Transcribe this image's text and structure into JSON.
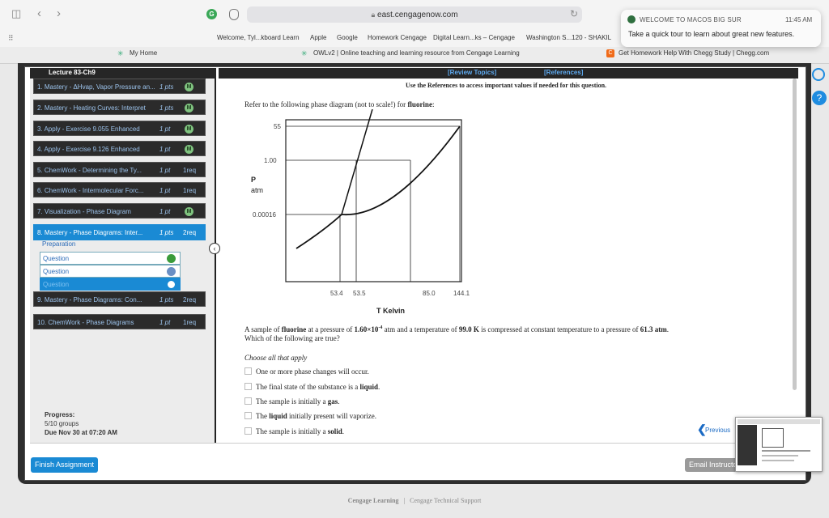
{
  "browser": {
    "url": "east.cengagenow.com",
    "favorites": [
      "Welcome, Tyl...kboard Learn",
      "Apple",
      "Google",
      "Homework Cengage",
      "Digital Learn...ks – Cengage",
      "Washington S...120 - SHAKIL"
    ],
    "tabs": [
      "My Home",
      "OWLv2 | Online teaching and learning resource from Cengage Learning",
      "Get Homework Help With Chegg Study | Chegg.com"
    ]
  },
  "notification": {
    "title": "WELCOME TO MACOS BIG SUR",
    "time": "11:45 AM",
    "body": "Take a quick tour to learn about great new features."
  },
  "sidebar": {
    "header": "Lecture 83-Ch9",
    "items": [
      {
        "label": "1. Mastery - ΔHvap, Vapor Pressure an...",
        "pts": "1 pts",
        "badge": "M"
      },
      {
        "label": "2. Mastery - Heating Curves: Interpret",
        "pts": "1 pts",
        "badge": "M"
      },
      {
        "label": "3. Apply - Exercise 9.055 Enhanced",
        "pts": "1 pt",
        "badge": "M"
      },
      {
        "label": "4. Apply - Exercise 9.126 Enhanced",
        "pts": "1 pt",
        "badge": "M"
      },
      {
        "label": "5. ChemWork - Determining the Ty...",
        "pts": "1 pt",
        "req": "1req"
      },
      {
        "label": "6. ChemWork - Intermolecular Forc...",
        "pts": "1 pt",
        "req": "1req"
      },
      {
        "label": "7. Visualization - Phase Diagram",
        "pts": "1 pt",
        "badge": "M"
      },
      {
        "label": "8. Mastery - Phase Diagrams: Inter...",
        "pts": "1 pts",
        "req": "2req"
      },
      {
        "label": "9. Mastery - Phase Diagrams: Con...",
        "pts": "1 pts",
        "req": "2req"
      },
      {
        "label": "10. ChemWork - Phase Diagrams",
        "pts": "1 pt",
        "req": "1req"
      }
    ],
    "subitems": [
      "Preparation",
      "Question",
      "Question",
      "Question"
    ],
    "progress_label": "Progress:",
    "progress_value": "5/10 groups",
    "due": "Due Nov 30 at 07:20 AM",
    "finish": "Finish Assignment"
  },
  "topbar": {
    "review": "[Review Topics]",
    "references": "[References]"
  },
  "content": {
    "use_refs": "Use the References to access important values if needed for this question.",
    "intro_a": "Refer to the following phase diagram (not to scale!) for ",
    "intro_b": "fluorine",
    "intro_c": ":",
    "q_a": "A sample of ",
    "q_b": "fluorine",
    "q_c": " at a pressure of ",
    "q_d": "1.60×10",
    "q_e": "-4",
    "q_f": " atm and a temperature of ",
    "q_g": "99.0 K",
    "q_h": " is compressed at constant temperature to a pressure of ",
    "q_i": "61.3 atm",
    "q_j": ".",
    "q_line2": "Which of the following are true?",
    "choose": "Choose all that apply",
    "options": [
      {
        "a": "One or more phase changes will occur.",
        "b": ""
      },
      {
        "a": "The final state of the substance is a ",
        "b": "liquid",
        "c": "."
      },
      {
        "a": "The sample is initially a ",
        "b": "gas",
        "c": "."
      },
      {
        "a": "The ",
        "b": "liquid",
        "c": " initially present will vaporize."
      },
      {
        "a": "The sample is initially a ",
        "b": "solid",
        "c": "."
      }
    ],
    "previous": "Previous",
    "email": "Email Instructor"
  },
  "diagram": {
    "ylabel_p": "P",
    "ylabel_atm": "atm",
    "xlabel": "T Kelvin",
    "yticks": [
      "55",
      "1.00",
      "0.00016"
    ],
    "xticks": [
      "53.4",
      "53.5",
      "85.0",
      "144.1"
    ]
  },
  "footer": {
    "left": "Cengage Learning",
    "sep": "|",
    "right": "Cengage Technical Support"
  }
}
